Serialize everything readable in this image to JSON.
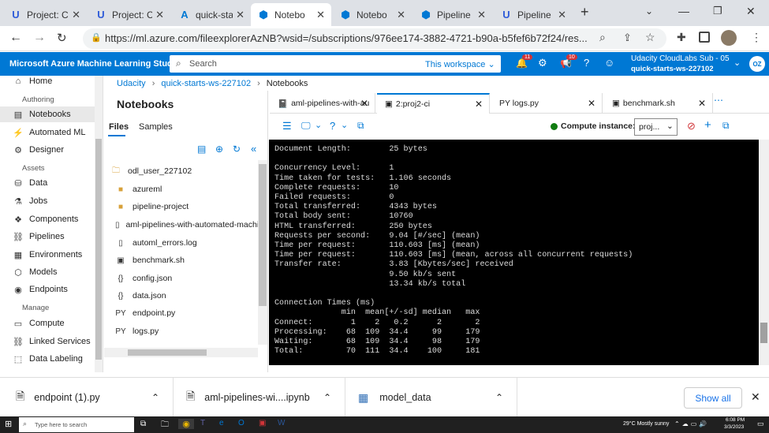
{
  "browser": {
    "tabs": [
      {
        "label": "Project: C",
        "icon": "udacity-icon",
        "active": false
      },
      {
        "label": "Project: C",
        "icon": "udacity-icon",
        "active": false
      },
      {
        "label": "quick-sta",
        "icon": "azure-icon",
        "active": false
      },
      {
        "label": "Notebo",
        "icon": "azure-ml-icon",
        "active": true
      },
      {
        "label": "Notebo",
        "icon": "azure-ml-icon",
        "active": false
      },
      {
        "label": "Pipeline",
        "icon": "azure-ml-icon",
        "active": false
      },
      {
        "label": "Pipeline",
        "icon": "udacity-icon",
        "active": false
      }
    ],
    "url": "https://ml.azure.com/fileexplorerAzNB?wsid=/subscriptions/976ee174-3882-4721-b90a-b5fef6b72f24/res..."
  },
  "azure": {
    "title": "Microsoft Azure Machine Learning Studio",
    "search_placeholder": "Search",
    "workspace_scope": "This workspace",
    "notif_badge_1": "11",
    "notif_badge_2": "10",
    "account_line1": "Udacity CloudLabs Sub - 05",
    "account_line2": "quick-starts-ws-227102",
    "avatar": "OZ",
    "accent": "#0078d4"
  },
  "nav": {
    "home": "Home",
    "authoring": "Authoring",
    "notebooks": "Notebooks",
    "automl": "Automated ML",
    "designer": "Designer",
    "assets": "Assets",
    "data": "Data",
    "jobs": "Jobs",
    "components": "Components",
    "pipelines": "Pipelines",
    "environments": "Environments",
    "models": "Models",
    "endpoints": "Endpoints",
    "manage": "Manage",
    "compute": "Compute",
    "linked": "Linked Services",
    "labeling": "Data Labeling"
  },
  "breadcrumb": {
    "a": "Udacity",
    "b": "quick-starts-ws-227102",
    "c": "Notebooks"
  },
  "files": {
    "heading": "Notebooks",
    "tab_files": "Files",
    "tab_samples": "Samples",
    "root": "odl_user_227102",
    "items": [
      {
        "name": "azureml",
        "icon": "folder-icon"
      },
      {
        "name": "pipeline-project",
        "icon": "folder-icon"
      },
      {
        "name": "aml-pipelines-with-automated-machine-learning-step.ipynb",
        "icon": "notebook-icon"
      },
      {
        "name": "automl_errors.log",
        "icon": "file-icon"
      },
      {
        "name": "benchmark.sh",
        "icon": "terminal-file-icon"
      },
      {
        "name": "config.json",
        "icon": "json-icon"
      },
      {
        "name": "data.json",
        "icon": "json-icon"
      },
      {
        "name": "endpoint.py",
        "icon": "python-icon"
      },
      {
        "name": "logs.py",
        "icon": "python-icon"
      }
    ]
  },
  "editor": {
    "tabs": [
      {
        "label": "aml-pipelines-with-au"
      },
      {
        "label": "2:proj2-ci"
      },
      {
        "label": "PY  logs.py"
      },
      {
        "label": "benchmark.sh"
      }
    ],
    "compute_label": "Compute instance:",
    "compute_value": "proj..."
  },
  "terminal": {
    "lines": [
      "Document Length:        25 bytes",
      "",
      "Concurrency Level:      1",
      "Time taken for tests:   1.106 seconds",
      "Complete requests:      10",
      "Failed requests:        0",
      "Total transferred:      4343 bytes",
      "Total body sent:        10760",
      "HTML transferred:       250 bytes",
      "Requests per second:    9.04 [#/sec] (mean)",
      "Time per request:       110.603 [ms] (mean)",
      "Time per request:       110.603 [ms] (mean, across all concurrent requests)",
      "Transfer rate:          3.83 [Kbytes/sec] received",
      "                        9.50 kb/s sent",
      "                        13.34 kb/s total",
      "",
      "Connection Times (ms)",
      "              min  mean[+/-sd] median   max",
      "Connect:        1    2   0.2      2       2",
      "Processing:    68  109  34.4     99     179",
      "Waiting:       68  109  34.4     98     179",
      "Total:         70  111  34.4    100     181"
    ]
  },
  "downloads": {
    "items": [
      {
        "name": "endpoint (1).py"
      },
      {
        "name": "aml-pipelines-wi....ipynb"
      },
      {
        "name": "model_data"
      }
    ],
    "show_all": "Show all"
  },
  "taskbar": {
    "search_placeholder": "Type here to search",
    "weather": "29°C  Mostly sunny",
    "time": "6:08 PM",
    "date": "3/3/2023"
  }
}
